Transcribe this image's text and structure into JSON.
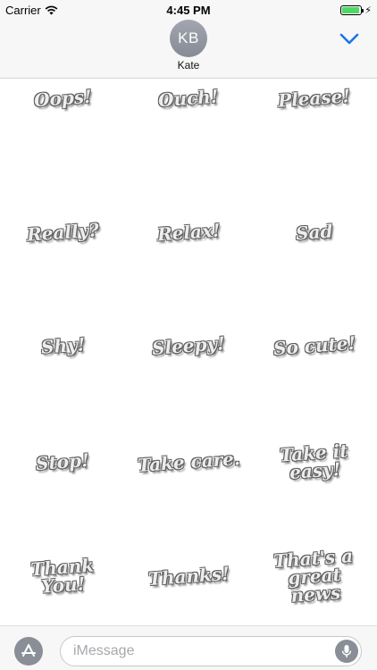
{
  "status_bar": {
    "carrier": "Carrier",
    "time": "4:45 PM",
    "battery_level": 0.95
  },
  "header": {
    "avatar_initials": "KB",
    "contact_name": "Kate"
  },
  "stickers": [
    "Oops!",
    "Ouch!",
    "Please!",
    "Really?",
    "Relax!",
    "Sad",
    "Shy!",
    "Sleepy!",
    "So cute!",
    "Stop!",
    "Take care.",
    "Take it easy!",
    "Thank You!",
    "Thanks!",
    "That's a great news"
  ],
  "input_bar": {
    "placeholder": "iMessage"
  },
  "icons": {
    "wifi": "wifi-icon",
    "battery": "battery-icon",
    "collapse": "chevron-down-icon",
    "appstore": "app-store-icon",
    "mic": "microphone-icon"
  },
  "colors": {
    "accent": "#1b74e8",
    "battery": "#4cd964",
    "icon_grey": "#8a8e97"
  }
}
